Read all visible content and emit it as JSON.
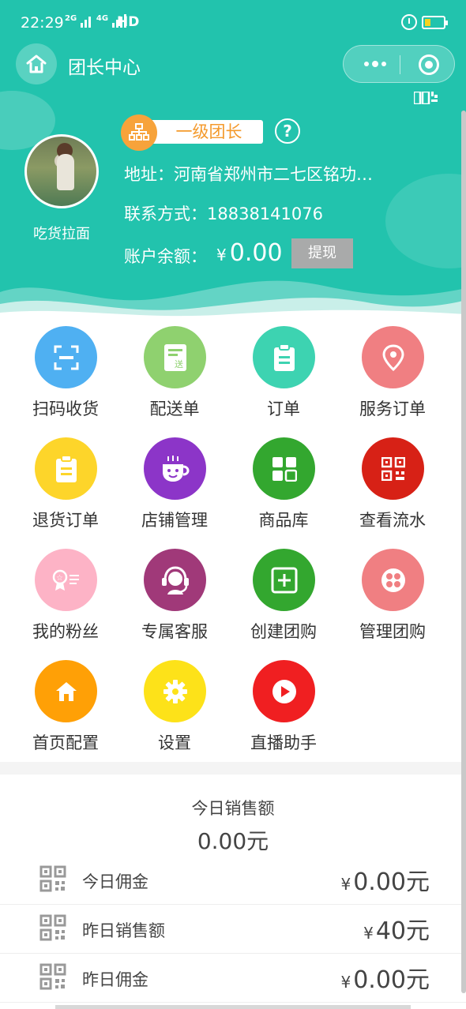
{
  "status_bar": {
    "time": "22:29",
    "signal1": "2G",
    "signal2": "4G",
    "hd": "HD"
  },
  "nav": {
    "title": "团长中心"
  },
  "profile": {
    "nickname": "吃货拉面",
    "level": "一级团长",
    "address": "地址：河南省郑州市二七区铭功…",
    "contact": "联系方式：18838141076",
    "balance_label": "账户余额：",
    "balance_currency": "¥",
    "balance_value": "0.00",
    "withdraw_label": "提现"
  },
  "grid": [
    {
      "label": "扫码收货",
      "icon": "scan-icon",
      "color": "#4fb0f2"
    },
    {
      "label": "配送单",
      "icon": "delivery-note-icon",
      "color": "#8fd16f"
    },
    {
      "label": "订单",
      "icon": "clipboard-icon",
      "color": "#3dd3b1"
    },
    {
      "label": "服务订单",
      "icon": "location-pin-icon",
      "color": "#f07f82"
    },
    {
      "label": "退货订单",
      "icon": "return-order-icon",
      "color": "#fdd52a"
    },
    {
      "label": "店铺管理",
      "icon": "shop-cup-icon",
      "color": "#8c35c8"
    },
    {
      "label": "商品库",
      "icon": "grid-squares-icon",
      "color": "#33a72f"
    },
    {
      "label": "查看流水",
      "icon": "qr-icon",
      "color": "#d72116"
    },
    {
      "label": "我的粉丝",
      "icon": "fan-card-icon",
      "color": "#fdb3c6"
    },
    {
      "label": "专属客服",
      "icon": "headset-icon",
      "color": "#a03979"
    },
    {
      "label": "创建团购",
      "icon": "plus-box-icon",
      "color": "#33a72f"
    },
    {
      "label": "管理团购",
      "icon": "flower-icon",
      "color": "#f07f82"
    },
    {
      "label": "首页配置",
      "icon": "home-icon",
      "color": "#ffa006"
    },
    {
      "label": "设置",
      "icon": "settings-gear-icon",
      "color": "#fde219"
    },
    {
      "label": "直播助手",
      "icon": "play-icon",
      "color": "#f01f21"
    }
  ],
  "stats": {
    "title": "今日销售额",
    "total": "0.00元",
    "rows": [
      {
        "name": "今日佣金",
        "currency": "¥",
        "value": "0.00元"
      },
      {
        "name": "昨日销售额",
        "currency": "¥",
        "value": "40元"
      },
      {
        "name": "昨日佣金",
        "currency": "¥",
        "value": "0.00元"
      }
    ]
  }
}
